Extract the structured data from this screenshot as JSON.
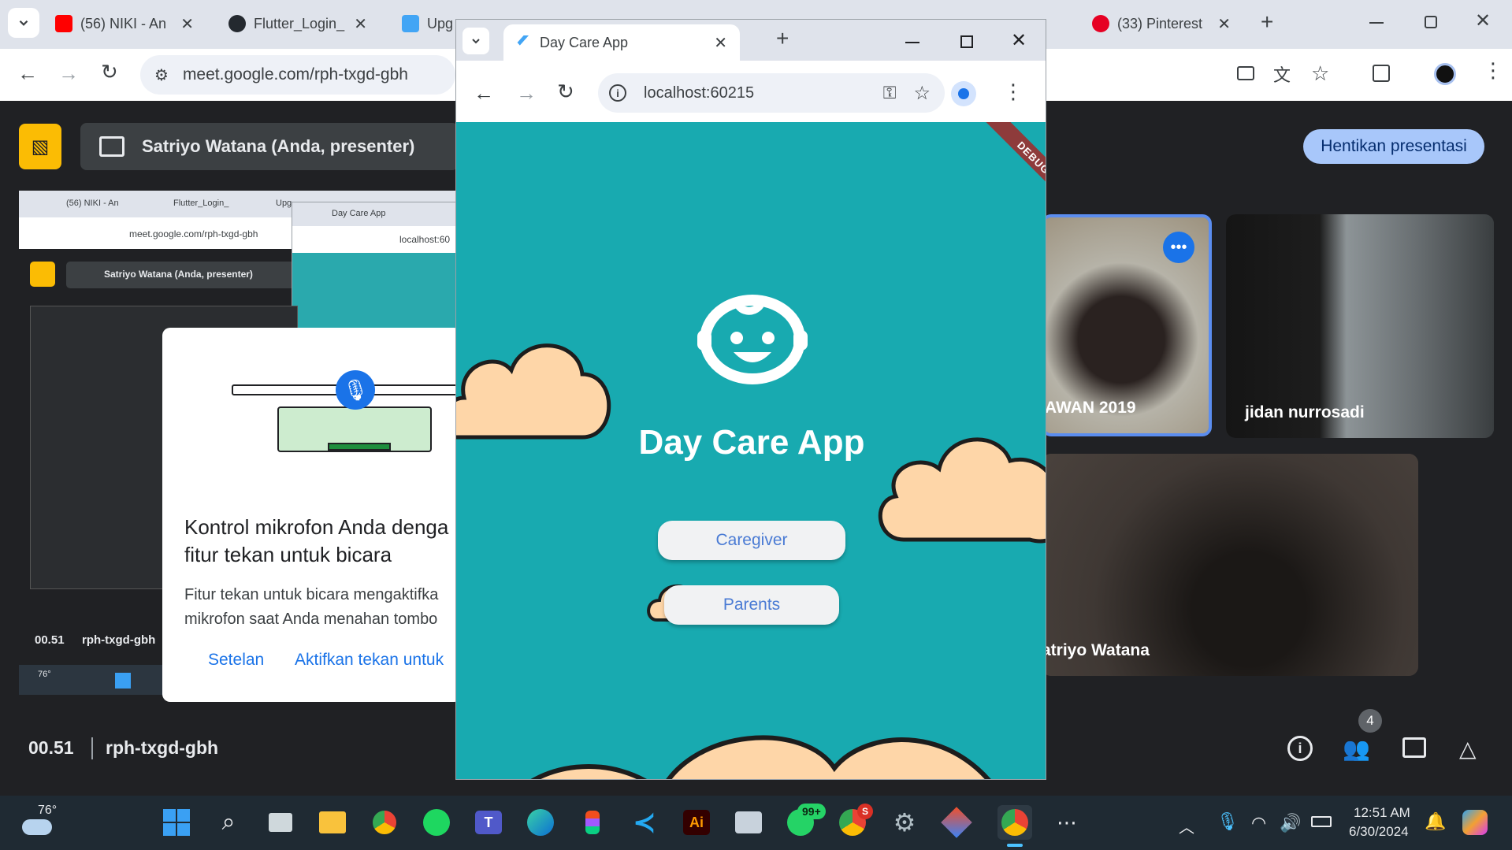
{
  "outer_browser": {
    "tabs": [
      {
        "title": "(56) NIKI - An",
        "fav_color": "#ff0000"
      },
      {
        "title": "Flutter_Login_",
        "fav_color": "#24292f"
      },
      {
        "title": "Upg",
        "fav_color": "#42a5f5"
      },
      {
        "title": "(33) Pinterest",
        "fav_color": "#e60023"
      }
    ],
    "new_tab": "+",
    "url": "meet.google.com/rph-txgd-gbh"
  },
  "meet": {
    "presenter_label": "Satriyo Watana (Anda, presenter)",
    "stop_button": "Hentikan presentasi",
    "meeting_time": "00.51",
    "meeting_code": "rph-txgd-gbh",
    "participants_count": "4",
    "tiles": [
      {
        "name": "AWAN 2019"
      },
      {
        "name": "jidan nurrosadi"
      },
      {
        "name": "atriyo Watana"
      }
    ],
    "nested_presenter": "Satriyo Watana (Anda, presenter)",
    "nested_tabs": [
      "(56) NIKI - An",
      "Flutter_Login_",
      "Upg"
    ],
    "nested_url": "meet.google.com/rph-txgd-gbh",
    "nested_inner_tab": "Day Care App",
    "nested_inner_url": "localhost:60",
    "nested_time": "00.51",
    "nested_code": "rph-txgd-gbh",
    "nested_weather": "76°"
  },
  "popup": {
    "title": "Kontrol mikrofon Anda denga fitur tekan untuk bicara",
    "body": "Fitur tekan untuk bicara mengaktifka mikrofon saat Anda menahan tombo",
    "settings_btn": "Setelan",
    "enable_btn": "Aktifkan tekan untuk"
  },
  "inner_browser": {
    "tab_title": "Day Care App",
    "new_tab": "+",
    "url": "localhost:60215"
  },
  "app": {
    "title": "Day Care App",
    "debug_banner": "DEBUG",
    "buttons": [
      "Caregiver",
      "Parents"
    ],
    "bg_color": "#18aab0",
    "cloud_color": "#fed6a8"
  },
  "taskbar": {
    "weather_temp": "76°",
    "whatsapp_badge": "99+",
    "chrome_badge": "S",
    "time": "12:51 AM",
    "date": "6/30/2024"
  }
}
